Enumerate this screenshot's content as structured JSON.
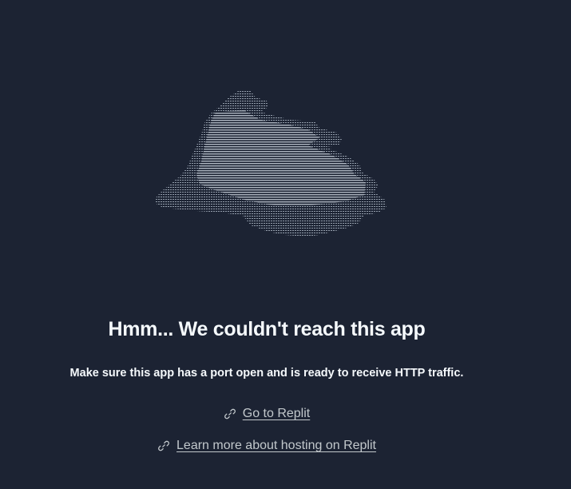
{
  "illustration": {
    "icon": "ascii-cloud-icon",
    "color": "#9aa6b4"
  },
  "error": {
    "title": "Hmm... We couldn't reach this app",
    "message": "Make sure this app has a port open and is ready to receive HTTP traffic."
  },
  "links": {
    "go_to_replit": {
      "icon": "link-icon",
      "label": "Go to Replit"
    },
    "learn_more": {
      "icon": "link-icon",
      "label": "Learn more about hosting on Replit"
    }
  },
  "colors": {
    "background": "#1c2333",
    "heading": "#f5f9fc",
    "link": "#c2c8cc"
  }
}
